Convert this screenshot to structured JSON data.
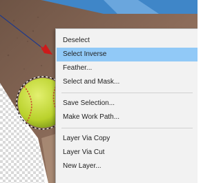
{
  "context_menu": {
    "items": [
      {
        "label": "Deselect",
        "highlighted": false
      },
      {
        "label": "Select Inverse",
        "highlighted": true
      },
      {
        "label": "Feather...",
        "highlighted": false
      },
      {
        "label": "Select and Mask...",
        "highlighted": false
      },
      {
        "label": "Save Selection...",
        "highlighted": false
      },
      {
        "label": "Make Work Path...",
        "highlighted": false
      },
      {
        "label": "Layer Via Copy",
        "highlighted": false
      },
      {
        "label": "Layer Via Cut",
        "highlighted": false
      },
      {
        "label": "New Layer...",
        "highlighted": false
      }
    ]
  },
  "colors": {
    "highlight": "#91c9f7",
    "annotation_arrow": "#cc1b1b",
    "softball": "#c6dd3a",
    "dirt": "#7a5a4a",
    "sky": "#3f86c8"
  }
}
